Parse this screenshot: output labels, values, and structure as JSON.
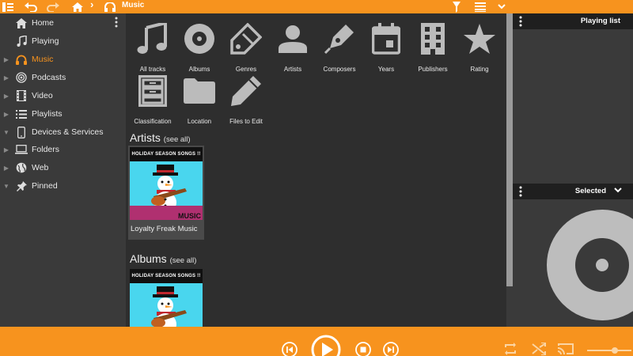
{
  "topbar": {
    "breadcrumb": "Music"
  },
  "sidebar": {
    "items": [
      {
        "label": "Home",
        "icon": "home-icon"
      },
      {
        "label": "Playing",
        "icon": "music-note-icon"
      },
      {
        "label": "Music",
        "icon": "headphones-icon"
      },
      {
        "label": "Podcasts",
        "icon": "podcast-icon"
      },
      {
        "label": "Video",
        "icon": "film-icon"
      },
      {
        "label": "Playlists",
        "icon": "playlist-icon"
      },
      {
        "label": "Devices & Services",
        "icon": "device-icon"
      },
      {
        "label": "Folders",
        "icon": "laptop-icon"
      },
      {
        "label": "Web",
        "icon": "globe-icon"
      },
      {
        "label": "Pinned",
        "icon": "pin-icon"
      }
    ],
    "active_index": 2,
    "accent": "#f7931e"
  },
  "categories": [
    {
      "label": "All tracks",
      "icon": "music-note-icon"
    },
    {
      "label": "Albums",
      "icon": "disc-icon"
    },
    {
      "label": "Genres",
      "icon": "tag-pencil-icon"
    },
    {
      "label": "Artists",
      "icon": "person-icon"
    },
    {
      "label": "Composers",
      "icon": "fountain-pen-icon"
    },
    {
      "label": "Years",
      "icon": "calendar-icon"
    },
    {
      "label": "Publishers",
      "icon": "building-icon"
    },
    {
      "label": "Rating",
      "icon": "star-icon"
    },
    {
      "label": "Classification",
      "icon": "cabinet-icon"
    },
    {
      "label": "Location",
      "icon": "folder-icon"
    },
    {
      "label": "Files to Edit",
      "icon": "pencil-icon"
    }
  ],
  "artists_section": {
    "title": "Artists",
    "see_all": "(see all)",
    "items": [
      {
        "name": "Loyalty Freak Music",
        "cover_banner": "HOLIDAY SEASON SONGS !!",
        "cover_text": "MUSIC"
      }
    ]
  },
  "albums_section": {
    "title": "Albums",
    "see_all": "(see all)",
    "items": [
      {
        "name": "",
        "cover_banner": "HOLIDAY SEASON SONGS !!"
      }
    ]
  },
  "right_panel": {
    "playing_list_title": "Playing list",
    "selected_title": "Selected"
  },
  "colors": {
    "accent": "#f7931e",
    "panel": "#3a3a3a",
    "content": "#2e2e2e"
  }
}
